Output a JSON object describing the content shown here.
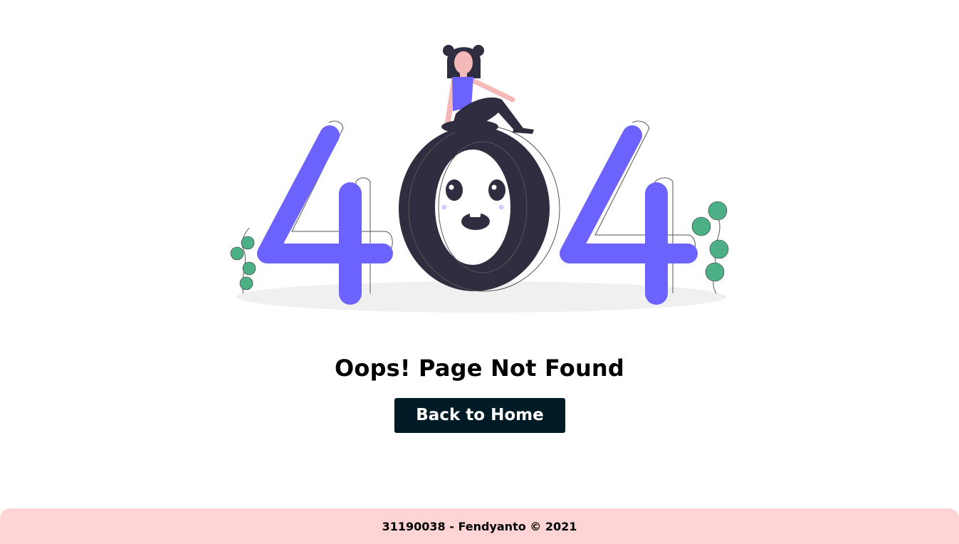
{
  "illustration": {
    "digits": [
      "4",
      "0",
      "4"
    ],
    "accent_color": "#6c63ff",
    "dark_color": "#2f2e41",
    "leaf_color": "#4caf86"
  },
  "main": {
    "heading": "Oops! Page Not Found",
    "home_button_label": "Back to Home",
    "button_color": "#011b26"
  },
  "footer": {
    "text": "31190038 - Fendyanto © 2021",
    "background": "#ffd4d4"
  }
}
